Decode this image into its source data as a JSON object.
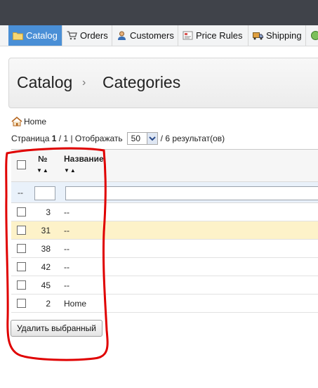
{
  "nav": {
    "tabs": [
      {
        "label": "Catalog",
        "icon": "folder-icon",
        "active": true
      },
      {
        "label": "Orders",
        "icon": "cart-icon",
        "active": false
      },
      {
        "label": "Customers",
        "icon": "user-icon",
        "active": false
      },
      {
        "label": "Price Rules",
        "icon": "price-tag-icon",
        "active": false
      },
      {
        "label": "Shipping",
        "icon": "truck-icon",
        "active": false
      }
    ]
  },
  "header": {
    "crumb1": "Catalog",
    "separator": "›",
    "crumb2": "Categories"
  },
  "home_link": "Home",
  "pager": {
    "prefix": "Страница",
    "page": "1",
    "of": "/ 1 | Отображать",
    "per_page": "50",
    "results": "/ 6 результат(ов)"
  },
  "grid": {
    "col_num": "№",
    "col_name": "Название",
    "sort_arrows": "▼▲",
    "filter_dash": "--",
    "rows": [
      {
        "id": "3",
        "name": "--",
        "highlight": false
      },
      {
        "id": "31",
        "name": "--",
        "highlight": true
      },
      {
        "id": "38",
        "name": "--",
        "highlight": false
      },
      {
        "id": "42",
        "name": "--",
        "highlight": false
      },
      {
        "id": "45",
        "name": "--",
        "highlight": false
      },
      {
        "id": "2",
        "name": "Home",
        "highlight": false
      }
    ]
  },
  "delete_button": "Удалить выбранный",
  "colors": {
    "topbar": "#40434a",
    "active_tab": "#4a8fd6",
    "highlight_row": "#fdf2c9",
    "annotation": "#e00000"
  }
}
